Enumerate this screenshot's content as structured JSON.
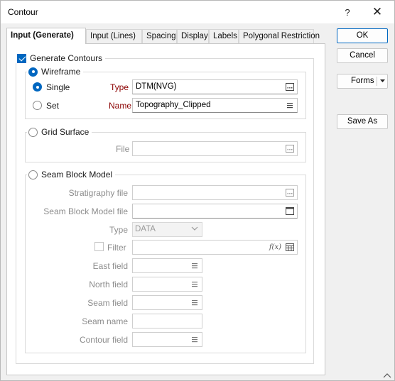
{
  "window": {
    "title": "Contour",
    "help_label": "?",
    "close_label": "✕"
  },
  "tabs": [
    {
      "label": "Input (Generate)",
      "active": true
    },
    {
      "label": "Input (Lines)",
      "active": false
    },
    {
      "label": "Spacing",
      "active": false
    },
    {
      "label": "Display",
      "active": false
    },
    {
      "label": "Labels",
      "active": false
    },
    {
      "label": "Polygonal Restriction",
      "active": false
    }
  ],
  "generate_contours": {
    "label": "Generate Contours",
    "checked": true
  },
  "wireframe": {
    "label": "Wireframe",
    "selected": true,
    "single_label": "Single",
    "single_selected": true,
    "set_label": "Set",
    "set_selected": false,
    "type_label": "Type",
    "type_value": "DTM(NVG)",
    "name_label": "Name",
    "name_value": "Topography_Clipped"
  },
  "grid_surface": {
    "label": "Grid Surface",
    "selected": false,
    "file_label": "File",
    "file_value": ""
  },
  "seam_block_model": {
    "label": "Seam Block Model",
    "selected": false,
    "stratigraphy_file_label": "Stratigraphy file",
    "stratigraphy_file_value": "",
    "seam_block_model_file_label": "Seam Block Model file",
    "seam_block_model_file_value": "",
    "type_label": "Type",
    "type_value": "DATA",
    "filter_label": "Filter",
    "filter_checked": false,
    "filter_value": "",
    "filter_fx_label": "f(x)",
    "east_field_label": "East field",
    "north_field_label": "North field",
    "seam_field_label": "Seam field",
    "seam_name_label": "Seam name",
    "contour_field_label": "Contour field"
  },
  "buttons": {
    "ok_label": "OK",
    "cancel_label": "Cancel",
    "forms_label": "Forms",
    "save_as_label": "Save As"
  },
  "colors": {
    "accent": "#0067c0",
    "required_label": "#8b0000",
    "disabled_text": "#8c8c8c"
  }
}
